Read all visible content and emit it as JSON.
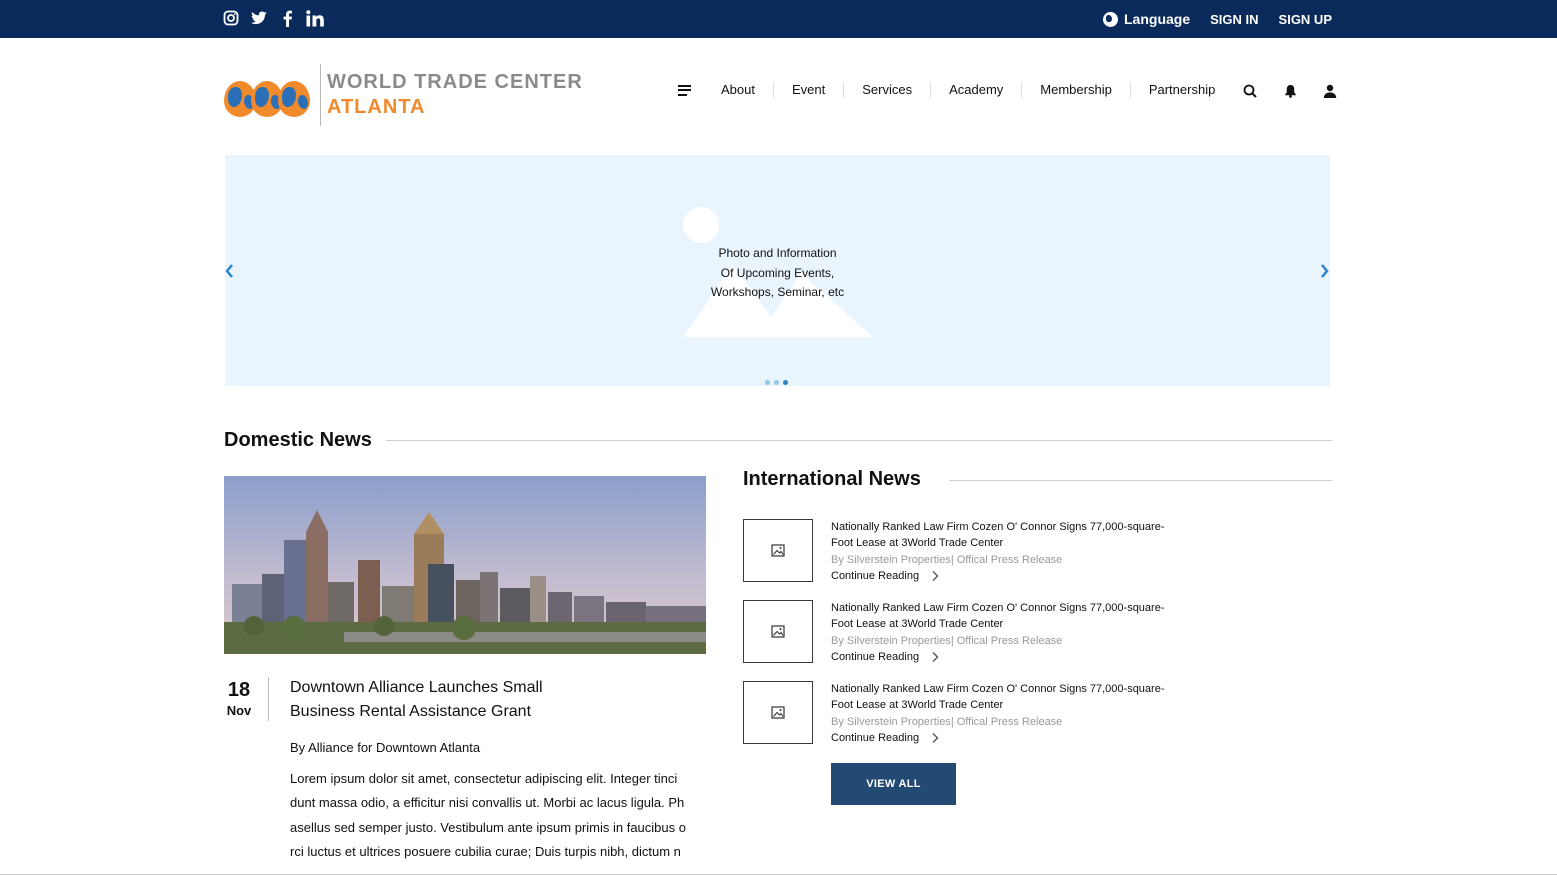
{
  "topbar": {
    "social_icons": [
      "instagram-icon",
      "twitter-icon",
      "facebook-icon",
      "linkedin-icon"
    ],
    "language_label": "Language",
    "sign_in": "SIGN IN",
    "sign_up": "SIGN UP"
  },
  "logo": {
    "line1": "WORLD TRADE CENTER",
    "line2": "ATLANTA"
  },
  "nav": {
    "items": [
      "About",
      "Event",
      "Services",
      "Academy",
      "Membership",
      "Partnership"
    ]
  },
  "hero": {
    "line1": "Photo and Information",
    "line2": "Of Upcoming Events,",
    "line3": "Workshops, Seminar, etc"
  },
  "domestic": {
    "title": "Domestic News",
    "day": "18",
    "month": "Nov",
    "headline_line1": "Downtown Alliance Launches Small",
    "headline_line2": "Business Rental Assistance Grant",
    "byline": "By Alliance for Downtown Atlanta",
    "body_lines": [
      "Lorem ipsum dolor sit amet, consectetur adipiscing elit. Integer tinci",
      "dunt massa odio, a efficitur nisi convallis ut. Morbi ac lacus ligula. Ph",
      "asellus sed semper justo. Vestibulum ante ipsum primis in faucibus o",
      "rci luctus et ultrices posuere cubilia curae; Duis turpis nibh, dictum n"
    ]
  },
  "international": {
    "title": "International News",
    "items": [
      {
        "title_line1": "Nationally Ranked Law Firm Cozen O' Connor Signs 77,000-square-",
        "title_line2": "Foot Lease at 3World Trade Center",
        "source": "By Silverstein Properties| Offical Press Release",
        "more": "Continue Reading"
      },
      {
        "title_line1": "Nationally Ranked Law Firm Cozen O' Connor Signs 77,000-square-",
        "title_line2": "Foot Lease at 3World Trade Center",
        "source": "By Silverstein Properties| Offical Press Release",
        "more": "Continue Reading"
      },
      {
        "title_line1": "Nationally Ranked Law Firm Cozen O' Connor Signs 77,000-square-",
        "title_line2": "Foot Lease at 3World Trade Center",
        "source": "By Silverstein Properties| Offical Press Release",
        "more": "Continue Reading"
      }
    ],
    "view_all": "VIEW ALL"
  },
  "colors": {
    "topbar": "#0a2a5c",
    "accent_orange": "#f08a2a",
    "hero_bg": "#eaf4fc",
    "button": "#234a73",
    "arrow": "#2a86c9"
  }
}
